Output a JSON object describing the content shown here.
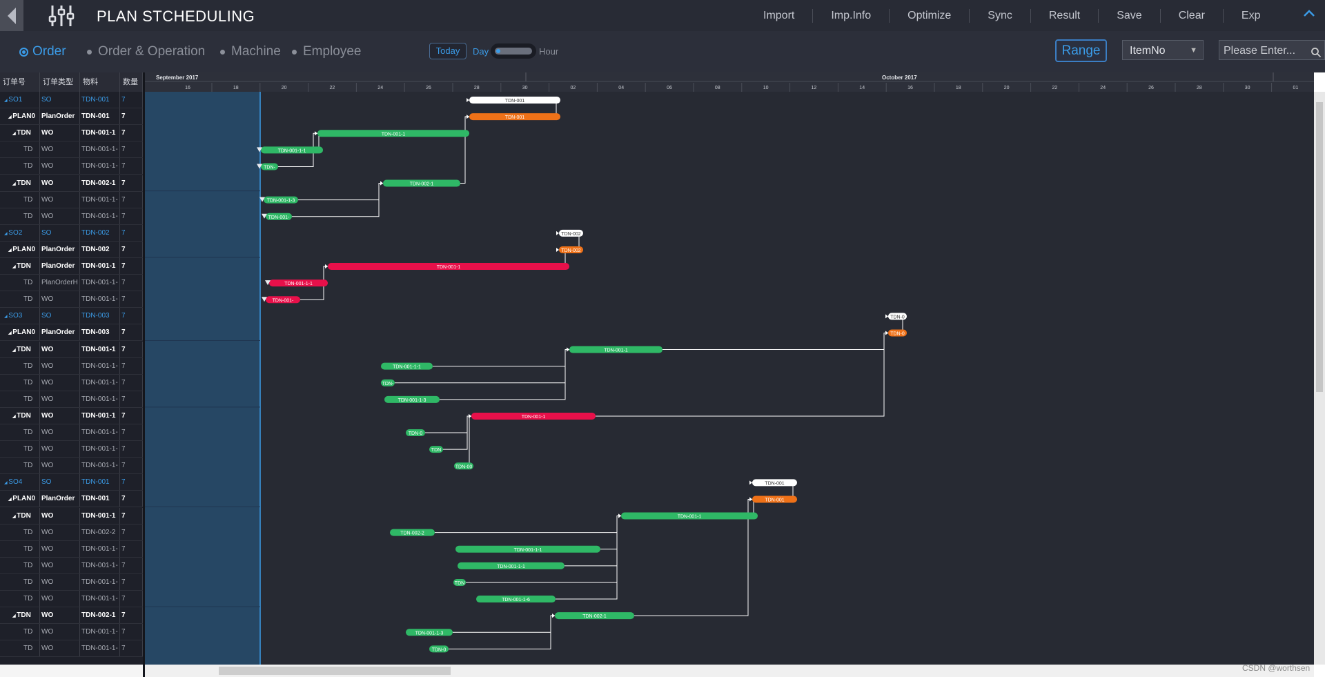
{
  "app": {
    "title": "PLAN STCHEDULING"
  },
  "menu": [
    "Import",
    "Imp.Info",
    "Optimize",
    "Sync",
    "Result",
    "Save",
    "Clear",
    "Exp"
  ],
  "views": [
    {
      "label": "Order",
      "selected": true
    },
    {
      "label": "Order & Operation",
      "selected": false
    },
    {
      "label": "Machine",
      "selected": false
    },
    {
      "label": "Employee",
      "selected": false
    }
  ],
  "timebar": {
    "today": "Today",
    "day": "Day",
    "hour": "Hour"
  },
  "filter": {
    "range": "Range",
    "field": "ItemNo",
    "search_placeholder": "Please Enter..."
  },
  "table": {
    "headers": [
      "订单号",
      "订单类型",
      "物料",
      "数量"
    ],
    "rows": [
      {
        "cells": [
          "SO1",
          "SO",
          "TDN-001",
          "7"
        ],
        "level": 0
      },
      {
        "cells": [
          "PLAN0",
          "PlanOrder",
          "TDN-001",
          "7"
        ],
        "level": 1
      },
      {
        "cells": [
          "TDN",
          "WO",
          "TDN-001-1",
          "7"
        ],
        "level": 2
      },
      {
        "cells": [
          "TD",
          "WO",
          "TDN-001-1-",
          "7"
        ],
        "level": 3
      },
      {
        "cells": [
          "TD",
          "WO",
          "TDN-001-1-",
          "7"
        ],
        "level": 3
      },
      {
        "cells": [
          "TDN",
          "WO",
          "TDN-002-1",
          "7"
        ],
        "level": 2
      },
      {
        "cells": [
          "TD",
          "WO",
          "TDN-001-1-",
          "7"
        ],
        "level": 3
      },
      {
        "cells": [
          "TD",
          "WO",
          "TDN-001-1-",
          "7"
        ],
        "level": 3
      },
      {
        "cells": [
          "SO2",
          "SO",
          "TDN-002",
          "7"
        ],
        "level": 0
      },
      {
        "cells": [
          "PLAN0",
          "PlanOrder",
          "TDN-002",
          "7"
        ],
        "level": 1
      },
      {
        "cells": [
          "TDN",
          "PlanOrder",
          "TDN-001-1",
          "7"
        ],
        "level": 2
      },
      {
        "cells": [
          "TD",
          "PlanOrderH",
          "TDN-001-1-",
          "7"
        ],
        "level": 3
      },
      {
        "cells": [
          "TD",
          "WO",
          "TDN-001-1-",
          "7"
        ],
        "level": 3
      },
      {
        "cells": [
          "SO3",
          "SO",
          "TDN-003",
          "7"
        ],
        "level": 0
      },
      {
        "cells": [
          "PLAN0",
          "PlanOrder",
          "TDN-003",
          "7"
        ],
        "level": 1
      },
      {
        "cells": [
          "TDN",
          "WO",
          "TDN-001-1",
          "7"
        ],
        "level": 2
      },
      {
        "cells": [
          "TD",
          "WO",
          "TDN-001-1-",
          "7"
        ],
        "level": 3
      },
      {
        "cells": [
          "TD",
          "WO",
          "TDN-001-1-",
          "7"
        ],
        "level": 3
      },
      {
        "cells": [
          "TD",
          "WO",
          "TDN-001-1-",
          "7"
        ],
        "level": 3
      },
      {
        "cells": [
          "TDN",
          "WO",
          "TDN-001-1",
          "7"
        ],
        "level": 2
      },
      {
        "cells": [
          "TD",
          "WO",
          "TDN-001-1-",
          "7"
        ],
        "level": 3
      },
      {
        "cells": [
          "TD",
          "WO",
          "TDN-001-1-",
          "7"
        ],
        "level": 3
      },
      {
        "cells": [
          "TD",
          "WO",
          "TDN-001-1-",
          "7"
        ],
        "level": 3
      },
      {
        "cells": [
          "SO4",
          "SO",
          "TDN-001",
          "7"
        ],
        "level": 0
      },
      {
        "cells": [
          "PLAN0",
          "PlanOrder",
          "TDN-001",
          "7"
        ],
        "level": 1
      },
      {
        "cells": [
          "TDN",
          "WO",
          "TDN-001-1",
          "7"
        ],
        "level": 2
      },
      {
        "cells": [
          "TD",
          "WO",
          "TDN-002-2",
          "7"
        ],
        "level": 3
      },
      {
        "cells": [
          "TD",
          "WO",
          "TDN-001-1-",
          "7"
        ],
        "level": 3
      },
      {
        "cells": [
          "TD",
          "WO",
          "TDN-001-1-",
          "7"
        ],
        "level": 3
      },
      {
        "cells": [
          "TD",
          "WO",
          "TDN-001-1-",
          "7"
        ],
        "level": 3
      },
      {
        "cells": [
          "TD",
          "WO",
          "TDN-001-1-",
          "7"
        ],
        "level": 3
      },
      {
        "cells": [
          "TDN",
          "WO",
          "TDN-002-1",
          "7"
        ],
        "level": 2
      },
      {
        "cells": [
          "TD",
          "WO",
          "TDN-001-1-",
          "7"
        ],
        "level": 3
      },
      {
        "cells": [
          "TD",
          "WO",
          "TDN-001-1-",
          "7"
        ],
        "level": 3
      }
    ]
  },
  "timeline": {
    "months": [
      "September 2017",
      "October 2017"
    ],
    "day_labels": [
      "16",
      "18",
      "20",
      "22",
      "24",
      "26",
      "28",
      "30",
      "02",
      "04",
      "06",
      "08",
      "10",
      "12",
      "14",
      "16",
      "18",
      "20",
      "22",
      "24",
      "26",
      "28",
      "30",
      "01"
    ]
  },
  "bars": [
    {
      "row": 0,
      "label": "TDN-001",
      "color": "white"
    },
    {
      "row": 1,
      "label": "TDN-001",
      "color": "orange"
    },
    {
      "row": 2,
      "label": "TDN-001-1",
      "color": "green"
    },
    {
      "row": 3,
      "label": "TDN-001-1-1",
      "color": "green"
    },
    {
      "row": 4,
      "label": "TDN-",
      "color": "green"
    },
    {
      "row": 5,
      "label": "TDN-002-1",
      "color": "green"
    },
    {
      "row": 6,
      "label": "TDN-001-1-3",
      "color": "green"
    },
    {
      "row": 7,
      "label": "TDN-001-",
      "color": "green"
    },
    {
      "row": 8,
      "label": "TDN-002",
      "color": "white"
    },
    {
      "row": 9,
      "label": "TDN-002",
      "color": "orange"
    },
    {
      "row": 10,
      "label": "TDN-001-1",
      "color": "red"
    },
    {
      "row": 11,
      "label": "TDN-001-1-1",
      "color": "red"
    },
    {
      "row": 12,
      "label": "TDN-001-",
      "color": "red"
    },
    {
      "row": 13,
      "label": "TDN-0",
      "color": "white"
    },
    {
      "row": 14,
      "label": "TDN-0",
      "color": "orange"
    },
    {
      "row": 15,
      "label": "TDN-001-1",
      "color": "green"
    },
    {
      "row": 16,
      "label": "TDN-001-1-1",
      "color": "green"
    },
    {
      "row": 17,
      "label": "TDN-",
      "color": "green"
    },
    {
      "row": 18,
      "label": "TDN-001-1-3",
      "color": "green"
    },
    {
      "row": 19,
      "label": "TDN-001-1",
      "color": "red"
    },
    {
      "row": 20,
      "label": "TDN-0",
      "color": "green"
    },
    {
      "row": 21,
      "label": "TDN",
      "color": "green"
    },
    {
      "row": 22,
      "label": "TDN-00",
      "color": "green"
    },
    {
      "row": 23,
      "label": "TDN-001",
      "color": "white"
    },
    {
      "row": 24,
      "label": "TDN-001",
      "color": "orange"
    },
    {
      "row": 25,
      "label": "TDN-001-1",
      "color": "green"
    },
    {
      "row": 26,
      "label": "TDN-002-2",
      "color": "green"
    },
    {
      "row": 27,
      "label": "TDN-001-1-1",
      "color": "green"
    },
    {
      "row": 28,
      "label": "TDN-001-1-1",
      "color": "green"
    },
    {
      "row": 29,
      "label": "TDN",
      "color": "green"
    },
    {
      "row": 30,
      "label": "TDN-001-1-6",
      "color": "green"
    },
    {
      "row": 31,
      "label": "TDN-002-1",
      "color": "green"
    },
    {
      "row": 32,
      "label": "TDN-001-1-3",
      "color": "green"
    },
    {
      "row": 33,
      "label": "TDN-0",
      "color": "green"
    }
  ],
  "colors": {
    "green": "#2fb866",
    "orange": "#ef7118",
    "red": "#e8104a",
    "white": "#ffffff",
    "accent": "#3b9ce8"
  },
  "watermark": "CSDN @worthsen"
}
